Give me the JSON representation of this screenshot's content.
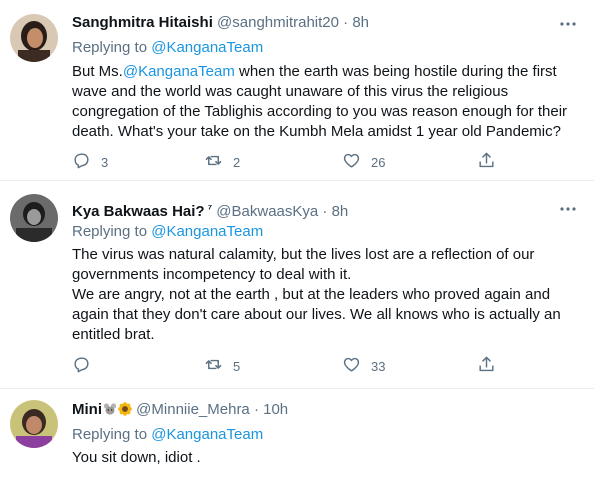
{
  "tweets": [
    {
      "name": "Sanghmitra Hitaishi",
      "handle": "@sanghmitrahit20",
      "separator": "·",
      "time": "8h",
      "replying_prefix": "Replying to ",
      "replying_to": "@KanganaTeam",
      "body_prefix": "But Ms.",
      "body_mention": "@KanganaTeam",
      "body_rest": " when the earth was being hostile during the first wave and the world was caught unaware of this virus the religious congregation of the Tablighis according to you was reason enough for their death. What's your take on the Kumbh Mela amidst 1 year old Pandemic?",
      "replies": "3",
      "retweets": "2",
      "likes": "26"
    },
    {
      "name": "Kya Bakwaas Hai?",
      "name_suffix": "⁷",
      "handle": "@BakwaasKya",
      "separator": "·",
      "time": "8h",
      "replying_prefix": "Replying to ",
      "replying_to": "@KanganaTeam",
      "body_line1": "The virus was natural calamity, but the lives lost are a reflection of our governments incompetency to deal with it.",
      "body_line2": "We are angry, not at the earth , but at the leaders who proved again and again that they don't care about our lives. We all knows who is actually an entitled brat.",
      "replies": "",
      "retweets": "5",
      "likes": "33"
    },
    {
      "name": "Mini",
      "name_emojis": [
        "mouse-emoji",
        "sunflower-emoji"
      ],
      "handle": "@Minniie_Mehra",
      "separator": "·",
      "time": "10h",
      "replying_prefix": "Replying to ",
      "replying_to": "@KanganaTeam",
      "body": "You sit down, idiot ."
    }
  ],
  "colors": {
    "link": "#1b95e0",
    "secondary": "#5b7083",
    "text": "#0f1419",
    "divider": "#e6ecf0"
  },
  "icons": [
    "reply-icon",
    "retweet-icon",
    "like-icon",
    "share-icon",
    "more-icon"
  ]
}
